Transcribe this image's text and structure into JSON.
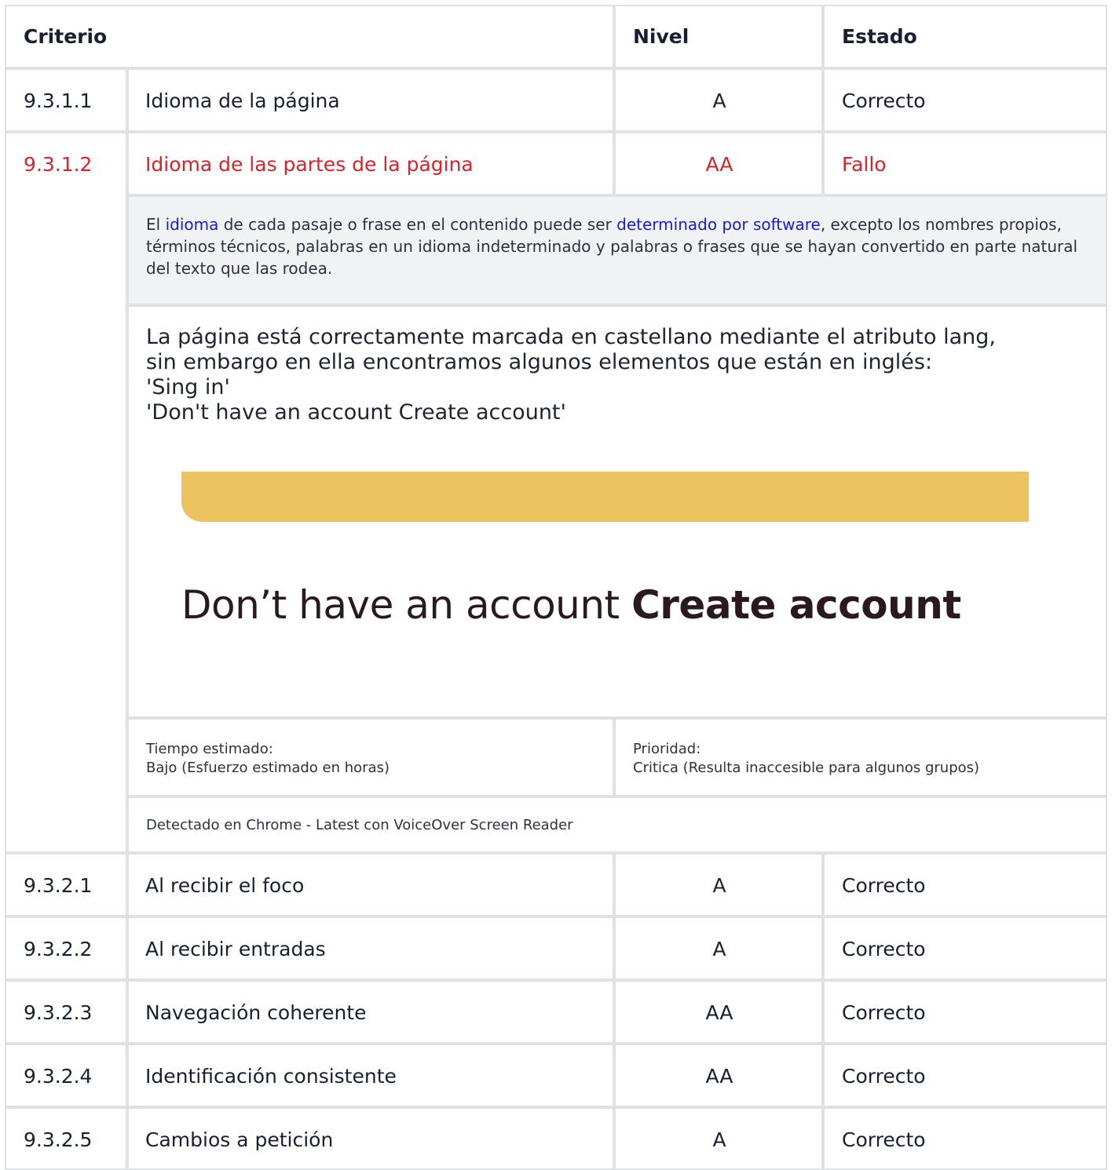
{
  "header": {
    "criterio": "Criterio",
    "nivel": "Nivel",
    "estado": "Estado"
  },
  "rows_top": [
    {
      "code": "9.3.1.1",
      "name": "Idioma de la página",
      "level": "A",
      "status": "Correcto"
    },
    {
      "code": "9.3.1.2",
      "name": "Idioma de las partes de la página",
      "level": "AA",
      "status": "Fallo"
    }
  ],
  "detail": {
    "desc_prefix": "El ",
    "desc_link1": "idioma",
    "desc_mid": " de cada pasaje o frase en el contenido puede ser ",
    "desc_link2": "determinado por software",
    "desc_suffix": ", excepto los nombres propios, términos técnicos, palabras en un idioma indeterminado y palabras o frases que se hayan convertido en parte natural del texto que las rodea.",
    "obs_line1": "La página está correctamente marcada en castellano mediante el atributo lang,",
    "obs_line2": "sin embargo en ella encontramos algunos elementos que están en inglés:",
    "obs_line3": "'Sing in'",
    "obs_line4": "'Don't have an account Create account'",
    "screenshot_text_regular": "Don’t have an account ",
    "screenshot_text_bold": "Create account",
    "screenshot_bar_color": "#ecc35f",
    "tiempo_label": "Tiempo estimado:",
    "tiempo_value": "Bajo (Esfuerzo estimado en horas)",
    "prioridad_label": "Prioridad:",
    "prioridad_value": "Critica (Resulta inaccesible para algunos grupos)",
    "detectado": "Detectado en Chrome - Latest con VoiceOver Screen Reader"
  },
  "rows_bottom": [
    {
      "code": "9.3.2.1",
      "name": "Al recibir el foco",
      "level": "A",
      "status": "Correcto"
    },
    {
      "code": "9.3.2.2",
      "name": "Al recibir entradas",
      "level": "A",
      "status": "Correcto"
    },
    {
      "code": "9.3.2.3",
      "name": "Navegación coherente",
      "level": "AA",
      "status": "Correcto"
    },
    {
      "code": "9.3.2.4",
      "name": "Identificación consistente",
      "level": "AA",
      "status": "Correcto"
    },
    {
      "code": "9.3.2.5",
      "name": "Cambios a petición",
      "level": "A",
      "status": "Correcto"
    }
  ],
  "colors": {
    "fail": "#d8232a",
    "border": "#dfe1e5",
    "desc_bg": "#f1f2f4",
    "link": "#1a1ad6"
  }
}
